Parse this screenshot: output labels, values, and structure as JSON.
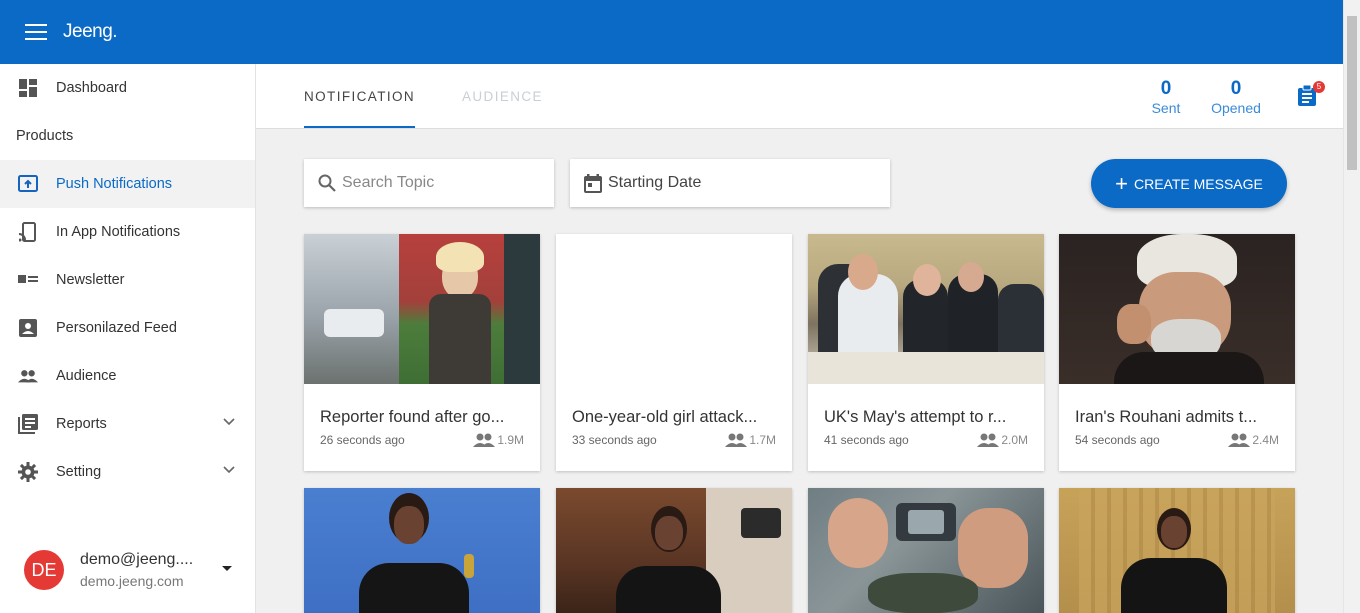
{
  "app": {
    "name": "Jeeng."
  },
  "sidebar": {
    "items": [
      {
        "label": "Dashboard"
      },
      {
        "label": "Products"
      },
      {
        "label": "Push Notifications"
      },
      {
        "label": "In App Notifications"
      },
      {
        "label": "Newsletter"
      },
      {
        "label": "Personilazed Feed"
      },
      {
        "label": "Audience"
      },
      {
        "label": "Reports"
      },
      {
        "label": "Setting"
      }
    ],
    "user": {
      "initials": "DE",
      "email": "demo@jeeng....",
      "site": "demo.jeeng.com"
    }
  },
  "tabs": [
    {
      "label": "NOTIFICATION"
    },
    {
      "label": "AUDIENCE"
    }
  ],
  "stats": {
    "sent_value": "0",
    "sent_label": "Sent",
    "opened_value": "0",
    "opened_label": "Opened",
    "badge": "5"
  },
  "filters": {
    "search_placeholder": "Search Topic",
    "date_label": "Starting Date"
  },
  "create_label": "CREATE MESSAGE",
  "cards": [
    {
      "title": "Reporter found after go...",
      "time": "26 seconds ago",
      "audience": "1.9M"
    },
    {
      "title": "One-year-old girl attack...",
      "time": "33 seconds ago",
      "audience": "1.7M"
    },
    {
      "title": "UK's May's attempt to r...",
      "time": "41 seconds ago",
      "audience": "2.0M"
    },
    {
      "title": "Iran's Rouhani admits t...",
      "time": "54 seconds ago",
      "audience": "2.4M"
    }
  ],
  "colors": {
    "primary": "#0a6ac6",
    "avatar": "#e53935",
    "badge": "#e53935"
  }
}
